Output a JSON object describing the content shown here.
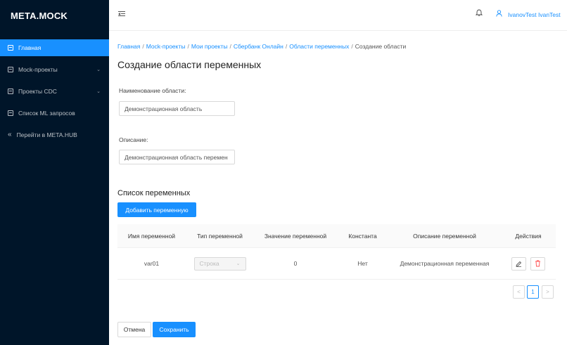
{
  "app": {
    "logo": "META.MOCK"
  },
  "sidebar": {
    "items": [
      {
        "label": "Главная",
        "icon": "page-icon",
        "active": true
      },
      {
        "label": "Mock-проекты",
        "icon": "page-icon",
        "chevron": "⌄"
      },
      {
        "label": "Проекты CDC",
        "icon": "page-icon",
        "chevron": "⌄"
      },
      {
        "label": "Список ML запросов",
        "icon": "page-icon"
      },
      {
        "label": "Перейти в META.HUB",
        "icon": "double-left-icon",
        "glyph": "«"
      }
    ]
  },
  "header": {
    "fold_icon": "menu-fold-icon",
    "bell_icon": "bell-icon",
    "user_icon": "user-icon",
    "user_name": "IvanovTest IvanTest"
  },
  "breadcrumb": {
    "links": [
      "Главная",
      "Mock-проекты",
      "Мои проекты",
      "Сбербанк Онлайн",
      "Области переменных"
    ],
    "separator": "/",
    "current": "Создание области"
  },
  "page": {
    "title": "Создание области переменных"
  },
  "form": {
    "name_label": "Наименование области:",
    "name_value": "Демонстрационная область",
    "description_label": "Описание:",
    "description_value": "Демонстрационная область перемен"
  },
  "variables": {
    "section_title": "Список переменных",
    "add_button": "Добавить переменную",
    "columns": [
      "Имя переменной",
      "Тип переменной",
      "Значение переменной",
      "Константа",
      "Описание переменной",
      "Действия"
    ],
    "rows": [
      {
        "name": "var01",
        "type": "Строка",
        "value": "0",
        "constant": "Нет",
        "description": "Демонстрационная переменная",
        "actions": [
          "edit-icon",
          "delete-icon"
        ]
      }
    ],
    "pagination": {
      "prev": "<",
      "current": "1",
      "next": ">"
    }
  },
  "footer": {
    "cancel": "Отмена",
    "save": "Сохранить"
  },
  "colors": {
    "accent": "#1890ff",
    "sidebar_bg": "#001529",
    "danger": "#ff4d4f"
  }
}
